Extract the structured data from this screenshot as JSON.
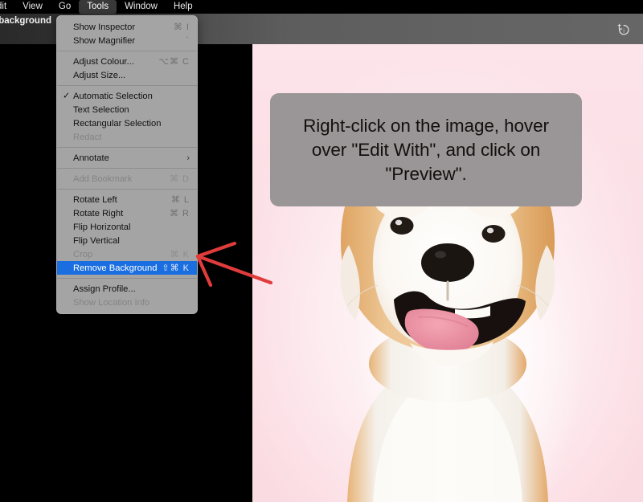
{
  "menubar": {
    "items": [
      {
        "label": "dit",
        "active": false,
        "truncated": true
      },
      {
        "label": "View",
        "active": false
      },
      {
        "label": "Go",
        "active": false
      },
      {
        "label": "Tools",
        "active": true
      },
      {
        "label": "Window",
        "active": false
      },
      {
        "label": "Help",
        "active": false
      }
    ]
  },
  "toolbar": {
    "title": "with background",
    "subtitle": "d",
    "revert_icon": "revert-sparkle-icon"
  },
  "callout": {
    "text": "Right-click on the image, hover over \"Edit With\", and click on \"Preview\".",
    "background_color": "#9a9596"
  },
  "menu": {
    "name": "Tools",
    "items": [
      {
        "label": "Show Inspector",
        "shortcut": "⌘ I",
        "disabled": false,
        "checked": false
      },
      {
        "label": "Show Magnifier",
        "shortcut": "`",
        "disabled": false,
        "checked": false
      },
      {
        "separator": true
      },
      {
        "label": "Adjust Colour...",
        "shortcut": "⌥⌘ C",
        "disabled": false,
        "checked": false
      },
      {
        "label": "Adjust Size...",
        "shortcut": "",
        "disabled": false,
        "checked": false
      },
      {
        "separator": true
      },
      {
        "label": "Automatic Selection",
        "shortcut": "",
        "disabled": false,
        "checked": true
      },
      {
        "label": "Text Selection",
        "shortcut": "",
        "disabled": false,
        "checked": false
      },
      {
        "label": "Rectangular Selection",
        "shortcut": "",
        "disabled": false,
        "checked": false
      },
      {
        "label": "Redact",
        "shortcut": "",
        "disabled": true,
        "checked": false
      },
      {
        "separator": true
      },
      {
        "label": "Annotate",
        "shortcut": "",
        "disabled": false,
        "checked": false,
        "submenu": true
      },
      {
        "separator": true
      },
      {
        "label": "Add Bookmark",
        "shortcut": "⌘ D",
        "disabled": true,
        "checked": false
      },
      {
        "separator": true
      },
      {
        "label": "Rotate Left",
        "shortcut": "⌘ L",
        "disabled": false,
        "checked": false
      },
      {
        "label": "Rotate Right",
        "shortcut": "⌘ R",
        "disabled": false,
        "checked": false
      },
      {
        "label": "Flip Horizontal",
        "shortcut": "",
        "disabled": false,
        "checked": false
      },
      {
        "label": "Flip Vertical",
        "shortcut": "",
        "disabled": false,
        "checked": false
      },
      {
        "label": "Crop",
        "shortcut": "⌘ K",
        "disabled": true,
        "checked": false
      },
      {
        "label": "Remove Background",
        "shortcut": "⇧⌘ K",
        "disabled": false,
        "checked": false,
        "selected": true
      },
      {
        "separator": true
      },
      {
        "label": "Assign Profile...",
        "shortcut": "",
        "disabled": false,
        "checked": false
      },
      {
        "label": "Show Location Info",
        "shortcut": "",
        "disabled": true,
        "checked": false
      }
    ]
  },
  "annotation": {
    "arrow_color": "#e03c3c",
    "arrow_target": "Remove Background"
  },
  "canvas": {
    "subject": "shiba-inu-dog-photo",
    "background_color": "#fbdde4"
  }
}
